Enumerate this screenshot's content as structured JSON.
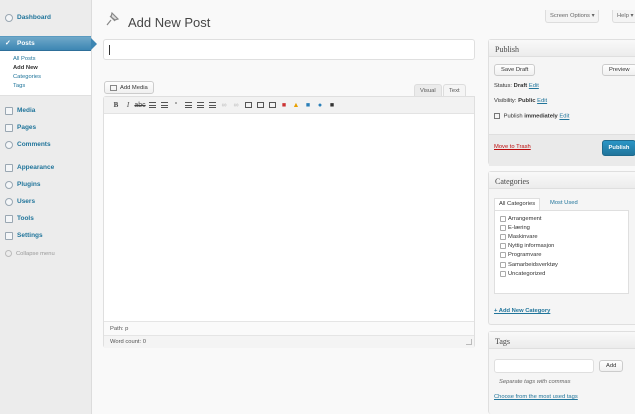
{
  "sidebar": {
    "items": [
      {
        "label": "Dashboard",
        "icon": "dashboard-icon"
      },
      {
        "label": "Posts",
        "icon": "pin-icon"
      },
      {
        "label": "Media",
        "icon": "media-icon"
      },
      {
        "label": "Pages",
        "icon": "pages-icon"
      },
      {
        "label": "Comments",
        "icon": "comments-icon"
      },
      {
        "label": "Appearance",
        "icon": "appearance-icon"
      },
      {
        "label": "Plugins",
        "icon": "plugins-icon"
      },
      {
        "label": "Users",
        "icon": "users-icon"
      },
      {
        "label": "Tools",
        "icon": "tools-icon"
      },
      {
        "label": "Settings",
        "icon": "settings-icon"
      }
    ],
    "posts_sub": [
      "All Posts",
      "Add New",
      "Categories",
      "Tags"
    ],
    "collapse_label": "Collapse menu"
  },
  "header": {
    "title": "Add New Post",
    "screen_options": "Screen Options ▾",
    "help": "Help ▾"
  },
  "editor": {
    "add_media": "Add Media",
    "tab_visual": "Visual",
    "tab_text": "Text",
    "path": "Path: p",
    "word_count": "Word count: 0"
  },
  "publish": {
    "title": "Publish",
    "save_draft": "Save Draft",
    "preview": "Preview",
    "status_label": "Status:",
    "status_value": "Draft",
    "visibility_label": "Visibility:",
    "visibility_value": "Public",
    "publish_label": "Publish",
    "publish_value": "immediately",
    "edit": "Edit",
    "trash": "Move to Trash",
    "publish_button": "Publish"
  },
  "categories": {
    "title": "Categories",
    "tab_all": "All Categories",
    "tab_used": "Most Used",
    "items": [
      "Arrangement",
      "E-læring",
      "Maskinvare",
      "Nyttig informasjon",
      "Programvare",
      "Samarbeidsverktøy",
      "Uncategorized"
    ],
    "add_new": "+ Add New Category"
  },
  "tags": {
    "title": "Tags",
    "add_button": "Add",
    "hint": "Separate tags with commas",
    "choose": "Choose from the most used tags"
  },
  "colors": {
    "link": "#21759b",
    "current_menu": "#3d86b3",
    "trash": "#bc0b0b"
  }
}
